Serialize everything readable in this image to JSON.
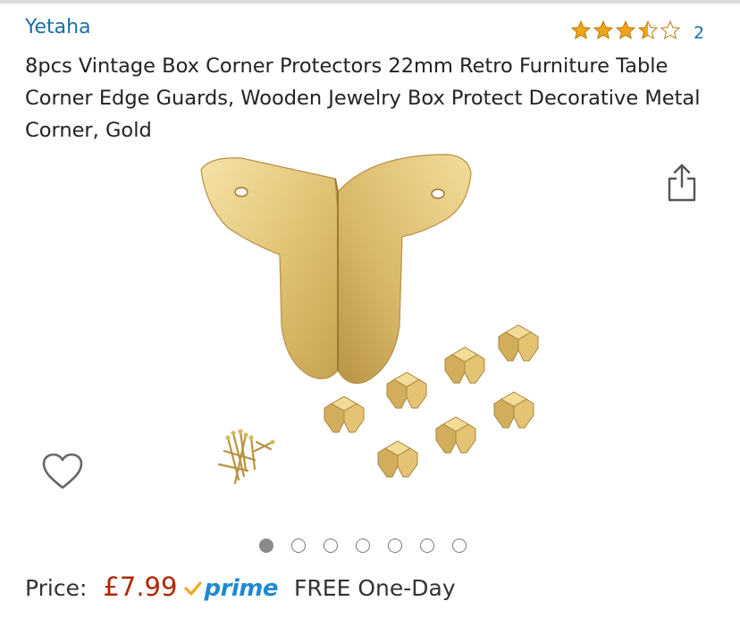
{
  "product": {
    "brand": "Yetaha",
    "rating_value": 3.5,
    "rating_count": "2",
    "title": "8pcs Vintage Box Corner Protectors 22mm Retro Furniture Table Corner Edge Guards, Wooden Jewelry Box Protect Decorative Metal Corner, Gold"
  },
  "gallery": {
    "image_count": 7,
    "active_index": 0
  },
  "pricing": {
    "label": "Price:",
    "price": "£7.99",
    "prime_label": "prime",
    "delivery": "FREE One-Day"
  },
  "colors": {
    "link": "#1a6fa6",
    "star": "#f0a41c",
    "price": "#b12704",
    "prime": "#1f8ad2",
    "prime_check": "#f5a623"
  },
  "icons": {
    "share": "share-icon",
    "favorite": "heart-icon",
    "prime_check": "check-icon"
  }
}
